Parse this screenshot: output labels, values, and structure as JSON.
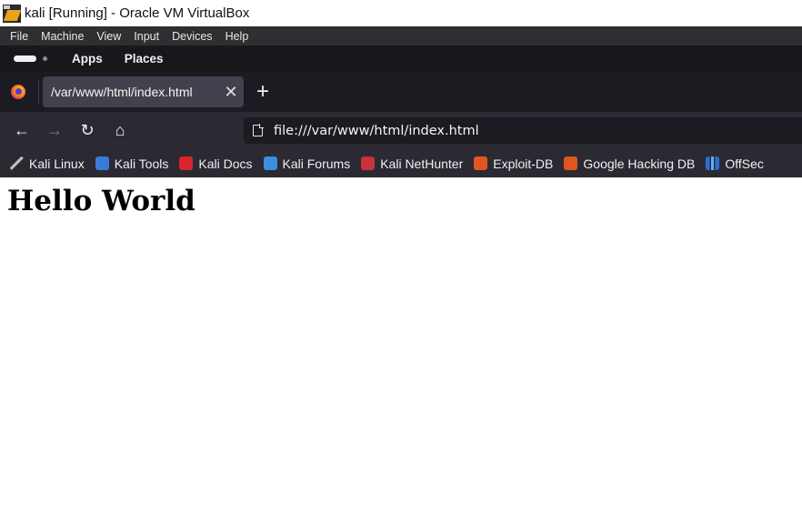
{
  "window": {
    "title": "kali [Running] - Oracle VM VirtualBox",
    "icon": "virtualbox-icon"
  },
  "vbox_menu": {
    "items": [
      {
        "label": "File"
      },
      {
        "label": "Machine"
      },
      {
        "label": "View"
      },
      {
        "label": "Input"
      },
      {
        "label": "Devices"
      },
      {
        "label": "Help"
      }
    ]
  },
  "kali_panel": {
    "workspace_indicator": "workspace-indicator",
    "apps_label": "Apps",
    "places_label": "Places"
  },
  "browser": {
    "logo": "firefox-icon",
    "tab": {
      "title": "/var/www/html/index.html",
      "close_glyph": "✕"
    },
    "new_tab_glyph": "+",
    "nav": {
      "back_glyph": "←",
      "forward_glyph": "→",
      "reload_glyph": "↻",
      "home_glyph": "⌂"
    },
    "url": "file:///var/www/html/index.html",
    "bookmarks": [
      {
        "label": "Kali Linux",
        "icon": "kali-linux-icon"
      },
      {
        "label": "Kali Tools",
        "icon": "kali-tools-icon"
      },
      {
        "label": "Kali Docs",
        "icon": "kali-docs-icon"
      },
      {
        "label": "Kali Forums",
        "icon": "kali-forums-icon"
      },
      {
        "label": "Kali NetHunter",
        "icon": "kali-nethunter-icon"
      },
      {
        "label": "Exploit-DB",
        "icon": "exploit-db-icon"
      },
      {
        "label": "Google Hacking DB",
        "icon": "ghdb-icon"
      },
      {
        "label": "OffSec",
        "icon": "offsec-icon"
      }
    ]
  },
  "page": {
    "heading": "Hello World"
  },
  "colors": {
    "vbox_menu_bg": "#2e2f30",
    "kali_panel_bg": "#16181c",
    "tabstrip_bg": "#1c1b22",
    "toolbar_bg": "#2b2a33",
    "active_tab_bg": "#42414d",
    "page_bg": "#ffffff"
  }
}
